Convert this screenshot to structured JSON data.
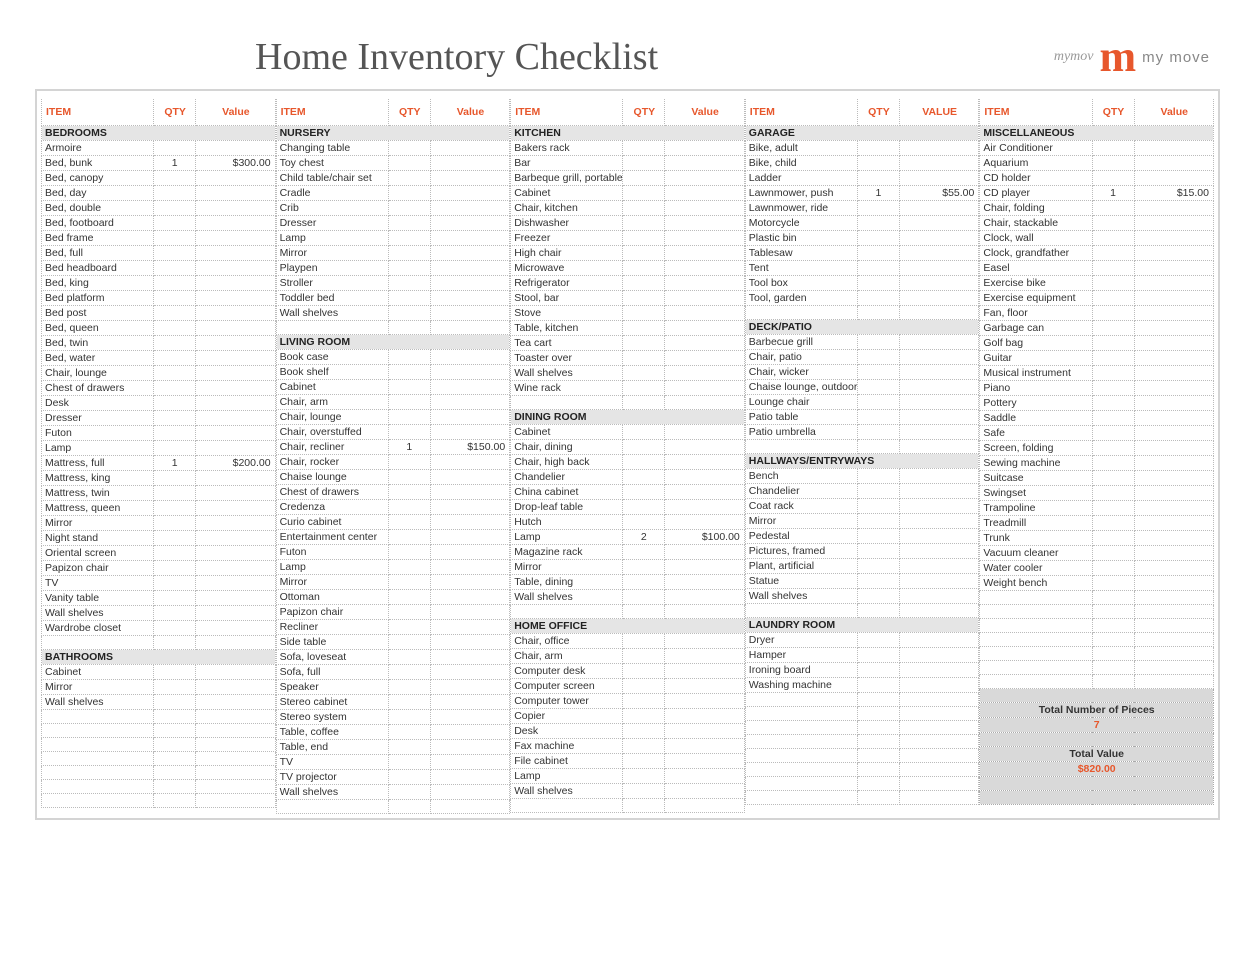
{
  "title": "Home Inventory Checklist",
  "logo": {
    "gray": "mymov",
    "m": "m",
    "sub": "my move"
  },
  "headers": {
    "item": "ITEM",
    "qty": "QTY",
    "value": "Value",
    "value_caps": "VALUE"
  },
  "summary": {
    "pieces_label": "Total Number of Pieces",
    "pieces_value": "7",
    "total_label": "Total Value",
    "total_value": "$820.00"
  },
  "columns": [
    [
      {
        "section": "BEDROOMS"
      },
      {
        "item": "Armoire",
        "qty": "",
        "val": ""
      },
      {
        "item": "Bed, bunk",
        "qty": "1",
        "val": "$300.00"
      },
      {
        "item": "Bed, canopy",
        "qty": "",
        "val": ""
      },
      {
        "item": "Bed, day",
        "qty": "",
        "val": ""
      },
      {
        "item": "Bed, double",
        "qty": "",
        "val": ""
      },
      {
        "item": "Bed, footboard",
        "qty": "",
        "val": ""
      },
      {
        "item": "Bed frame",
        "qty": "",
        "val": ""
      },
      {
        "item": "Bed, full",
        "qty": "",
        "val": ""
      },
      {
        "item": "Bed headboard",
        "qty": "",
        "val": ""
      },
      {
        "item": "Bed, king",
        "qty": "",
        "val": ""
      },
      {
        "item": "Bed platform",
        "qty": "",
        "val": ""
      },
      {
        "item": "Bed post",
        "qty": "",
        "val": ""
      },
      {
        "item": "Bed, queen",
        "qty": "",
        "val": ""
      },
      {
        "item": "Bed, twin",
        "qty": "",
        "val": ""
      },
      {
        "item": "Bed, water",
        "qty": "",
        "val": ""
      },
      {
        "item": "Chair, lounge",
        "qty": "",
        "val": ""
      },
      {
        "item": "Chest of drawers",
        "qty": "",
        "val": ""
      },
      {
        "item": "Desk",
        "qty": "",
        "val": ""
      },
      {
        "item": "Dresser",
        "qty": "",
        "val": ""
      },
      {
        "item": "Futon",
        "qty": "",
        "val": ""
      },
      {
        "item": "Lamp",
        "qty": "",
        "val": ""
      },
      {
        "item": "Mattress, full",
        "qty": "1",
        "val": "$200.00"
      },
      {
        "item": "Mattress, king",
        "qty": "",
        "val": ""
      },
      {
        "item": "Mattress, twin",
        "qty": "",
        "val": ""
      },
      {
        "item": "Mattress, queen",
        "qty": "",
        "val": ""
      },
      {
        "item": "Mirror",
        "qty": "",
        "val": ""
      },
      {
        "item": "Night stand",
        "qty": "",
        "val": ""
      },
      {
        "item": "Oriental screen",
        "qty": "",
        "val": ""
      },
      {
        "item": "Papizon chair",
        "qty": "",
        "val": ""
      },
      {
        "item": "TV",
        "qty": "",
        "val": ""
      },
      {
        "item": "Vanity table",
        "qty": "",
        "val": ""
      },
      {
        "item": "Wall shelves",
        "qty": "",
        "val": ""
      },
      {
        "item": "Wardrobe closet",
        "qty": "",
        "val": ""
      },
      {
        "item": "",
        "qty": "",
        "val": ""
      },
      {
        "section": "BATHROOMS"
      },
      {
        "item": "Cabinet",
        "qty": "",
        "val": ""
      },
      {
        "item": "Mirror",
        "qty": "",
        "val": ""
      },
      {
        "item": "Wall shelves",
        "qty": "",
        "val": ""
      },
      {
        "item": "",
        "qty": "",
        "val": ""
      },
      {
        "item": "",
        "qty": "",
        "val": ""
      },
      {
        "item": "",
        "qty": "",
        "val": ""
      },
      {
        "item": "",
        "qty": "",
        "val": ""
      },
      {
        "item": "",
        "qty": "",
        "val": ""
      },
      {
        "item": "",
        "qty": "",
        "val": ""
      },
      {
        "item": "",
        "qty": "",
        "val": ""
      }
    ],
    [
      {
        "section": "NURSERY"
      },
      {
        "item": "Changing table",
        "qty": "",
        "val": ""
      },
      {
        "item": "Toy chest",
        "qty": "",
        "val": ""
      },
      {
        "item": "Child table/chair set",
        "qty": "",
        "val": ""
      },
      {
        "item": "Cradle",
        "qty": "",
        "val": ""
      },
      {
        "item": "Crib",
        "qty": "",
        "val": ""
      },
      {
        "item": "Dresser",
        "qty": "",
        "val": ""
      },
      {
        "item": "Lamp",
        "qty": "",
        "val": ""
      },
      {
        "item": "Mirror",
        "qty": "",
        "val": ""
      },
      {
        "item": "Playpen",
        "qty": "",
        "val": ""
      },
      {
        "item": "Stroller",
        "qty": "",
        "val": ""
      },
      {
        "item": "Toddler bed",
        "qty": "",
        "val": ""
      },
      {
        "item": "Wall shelves",
        "qty": "",
        "val": ""
      },
      {
        "item": "",
        "qty": "",
        "val": ""
      },
      {
        "section": "LIVING ROOM"
      },
      {
        "item": "Book case",
        "qty": "",
        "val": ""
      },
      {
        "item": "Book shelf",
        "qty": "",
        "val": ""
      },
      {
        "item": "Cabinet",
        "qty": "",
        "val": ""
      },
      {
        "item": "Chair, arm",
        "qty": "",
        "val": ""
      },
      {
        "item": "Chair, lounge",
        "qty": "",
        "val": ""
      },
      {
        "item": "Chair, overstuffed",
        "qty": "",
        "val": ""
      },
      {
        "item": "Chair, recliner",
        "qty": "1",
        "val": "$150.00"
      },
      {
        "item": "Chair, rocker",
        "qty": "",
        "val": ""
      },
      {
        "item": "Chaise lounge",
        "qty": "",
        "val": ""
      },
      {
        "item": "Chest of drawers",
        "qty": "",
        "val": ""
      },
      {
        "item": "Credenza",
        "qty": "",
        "val": ""
      },
      {
        "item": "Curio cabinet",
        "qty": "",
        "val": ""
      },
      {
        "item": "Entertainment center",
        "qty": "",
        "val": ""
      },
      {
        "item": "Futon",
        "qty": "",
        "val": ""
      },
      {
        "item": "Lamp",
        "qty": "",
        "val": ""
      },
      {
        "item": "Mirror",
        "qty": "",
        "val": ""
      },
      {
        "item": "Ottoman",
        "qty": "",
        "val": ""
      },
      {
        "item": "Papizon chair",
        "qty": "",
        "val": ""
      },
      {
        "item": "Recliner",
        "qty": "",
        "val": ""
      },
      {
        "item": "Side table",
        "qty": "",
        "val": ""
      },
      {
        "item": "Sofa, loveseat",
        "qty": "",
        "val": ""
      },
      {
        "item": "Sofa, full",
        "qty": "",
        "val": ""
      },
      {
        "item": "Speaker",
        "qty": "",
        "val": ""
      },
      {
        "item": "Stereo cabinet",
        "qty": "",
        "val": ""
      },
      {
        "item": "Stereo system",
        "qty": "",
        "val": ""
      },
      {
        "item": "Table, coffee",
        "qty": "",
        "val": ""
      },
      {
        "item": "Table, end",
        "qty": "",
        "val": ""
      },
      {
        "item": "TV",
        "qty": "",
        "val": ""
      },
      {
        "item": "TV projector",
        "qty": "",
        "val": ""
      },
      {
        "item": "Wall shelves",
        "qty": "",
        "val": ""
      },
      {
        "item": "",
        "qty": "",
        "val": ""
      }
    ],
    [
      {
        "section": "KITCHEN"
      },
      {
        "item": "Bakers rack",
        "qty": "",
        "val": ""
      },
      {
        "item": "Bar",
        "qty": "",
        "val": ""
      },
      {
        "item": "Barbeque grill, portable",
        "qty": "",
        "val": ""
      },
      {
        "item": "Cabinet",
        "qty": "",
        "val": ""
      },
      {
        "item": "Chair, kitchen",
        "qty": "",
        "val": ""
      },
      {
        "item": "Dishwasher",
        "qty": "",
        "val": ""
      },
      {
        "item": "Freezer",
        "qty": "",
        "val": ""
      },
      {
        "item": "High chair",
        "qty": "",
        "val": ""
      },
      {
        "item": "Microwave",
        "qty": "",
        "val": ""
      },
      {
        "item": "Refrigerator",
        "qty": "",
        "val": ""
      },
      {
        "item": "Stool, bar",
        "qty": "",
        "val": ""
      },
      {
        "item": "Stove",
        "qty": "",
        "val": ""
      },
      {
        "item": "Table, kitchen",
        "qty": "",
        "val": ""
      },
      {
        "item": "Tea cart",
        "qty": "",
        "val": ""
      },
      {
        "item": "Toaster over",
        "qty": "",
        "val": ""
      },
      {
        "item": "Wall shelves",
        "qty": "",
        "val": ""
      },
      {
        "item": "Wine rack",
        "qty": "",
        "val": ""
      },
      {
        "item": "",
        "qty": "",
        "val": ""
      },
      {
        "section": "DINING ROOM"
      },
      {
        "item": "Cabinet",
        "qty": "",
        "val": ""
      },
      {
        "item": "Chair, dining",
        "qty": "",
        "val": ""
      },
      {
        "item": "Chair, high back",
        "qty": "",
        "val": ""
      },
      {
        "item": "Chandelier",
        "qty": "",
        "val": ""
      },
      {
        "item": "China cabinet",
        "qty": "",
        "val": ""
      },
      {
        "item": "Drop-leaf table",
        "qty": "",
        "val": ""
      },
      {
        "item": "Hutch",
        "qty": "",
        "val": ""
      },
      {
        "item": "Lamp",
        "qty": "2",
        "val": "$100.00"
      },
      {
        "item": "Magazine rack",
        "qty": "",
        "val": ""
      },
      {
        "item": "Mirror",
        "qty": "",
        "val": ""
      },
      {
        "item": "Table, dining",
        "qty": "",
        "val": ""
      },
      {
        "item": "Wall shelves",
        "qty": "",
        "val": ""
      },
      {
        "item": "",
        "qty": "",
        "val": ""
      },
      {
        "section": "HOME OFFICE"
      },
      {
        "item": "Chair, office",
        "qty": "",
        "val": ""
      },
      {
        "item": "Chair, arm",
        "qty": "",
        "val": ""
      },
      {
        "item": "Computer desk",
        "qty": "",
        "val": ""
      },
      {
        "item": "Computer screen",
        "qty": "",
        "val": ""
      },
      {
        "item": "Computer tower",
        "qty": "",
        "val": ""
      },
      {
        "item": "Copier",
        "qty": "",
        "val": ""
      },
      {
        "item": "Desk",
        "qty": "",
        "val": ""
      },
      {
        "item": "Fax machine",
        "qty": "",
        "val": ""
      },
      {
        "item": "File cabinet",
        "qty": "",
        "val": ""
      },
      {
        "item": "Lamp",
        "qty": "",
        "val": ""
      },
      {
        "item": "Wall shelves",
        "qty": "",
        "val": ""
      },
      {
        "item": "",
        "qty": "",
        "val": ""
      }
    ],
    [
      {
        "section": "GARAGE"
      },
      {
        "item": "Bike, adult",
        "qty": "",
        "val": ""
      },
      {
        "item": "Bike, child",
        "qty": "",
        "val": ""
      },
      {
        "item": "Ladder",
        "qty": "",
        "val": ""
      },
      {
        "item": "Lawnmower, push",
        "qty": "1",
        "val": "$55.00"
      },
      {
        "item": "Lawnmower, ride",
        "qty": "",
        "val": ""
      },
      {
        "item": "Motorcycle",
        "qty": "",
        "val": ""
      },
      {
        "item": "Plastic bin",
        "qty": "",
        "val": ""
      },
      {
        "item": "Tablesaw",
        "qty": "",
        "val": ""
      },
      {
        "item": "Tent",
        "qty": "",
        "val": ""
      },
      {
        "item": "Tool box",
        "qty": "",
        "val": ""
      },
      {
        "item": "Tool, garden",
        "qty": "",
        "val": ""
      },
      {
        "item": "",
        "qty": "",
        "val": ""
      },
      {
        "section": "DECK/PATIO"
      },
      {
        "item": "Barbecue grill",
        "qty": "",
        "val": ""
      },
      {
        "item": "Chair, patio",
        "qty": "",
        "val": ""
      },
      {
        "item": "Chair, wicker",
        "qty": "",
        "val": ""
      },
      {
        "item": "Chaise lounge, outdoor",
        "qty": "",
        "val": ""
      },
      {
        "item": "Lounge chair",
        "qty": "",
        "val": ""
      },
      {
        "item": "Patio table",
        "qty": "",
        "val": ""
      },
      {
        "item": "Patio umbrella",
        "qty": "",
        "val": ""
      },
      {
        "item": "",
        "qty": "",
        "val": ""
      },
      {
        "section": "HALLWAYS/ENTRYWAYS"
      },
      {
        "item": "Bench",
        "qty": "",
        "val": ""
      },
      {
        "item": "Chandelier",
        "qty": "",
        "val": ""
      },
      {
        "item": "Coat rack",
        "qty": "",
        "val": ""
      },
      {
        "item": "Mirror",
        "qty": "",
        "val": ""
      },
      {
        "item": "Pedestal",
        "qty": "",
        "val": ""
      },
      {
        "item": "Pictures, framed",
        "qty": "",
        "val": ""
      },
      {
        "item": "Plant, artificial",
        "qty": "",
        "val": ""
      },
      {
        "item": "Statue",
        "qty": "",
        "val": ""
      },
      {
        "item": "Wall shelves",
        "qty": "",
        "val": ""
      },
      {
        "item": "",
        "qty": "",
        "val": ""
      },
      {
        "section": "LAUNDRY ROOM"
      },
      {
        "item": "Dryer",
        "qty": "",
        "val": ""
      },
      {
        "item": "Hamper",
        "qty": "",
        "val": ""
      },
      {
        "item": "Ironing board",
        "qty": "",
        "val": ""
      },
      {
        "item": "Washing machine",
        "qty": "",
        "val": ""
      },
      {
        "item": "",
        "qty": "",
        "val": ""
      },
      {
        "item": "",
        "qty": "",
        "val": ""
      },
      {
        "item": "",
        "qty": "",
        "val": ""
      },
      {
        "item": "",
        "qty": "",
        "val": ""
      },
      {
        "item": "",
        "qty": "",
        "val": ""
      },
      {
        "item": "",
        "qty": "",
        "val": ""
      },
      {
        "item": "",
        "qty": "",
        "val": ""
      },
      {
        "item": "",
        "qty": "",
        "val": ""
      }
    ],
    [
      {
        "section": "MISCELLANEOUS"
      },
      {
        "item": "Air Conditioner",
        "qty": "",
        "val": ""
      },
      {
        "item": "Aquarium",
        "qty": "",
        "val": ""
      },
      {
        "item": "CD holder",
        "qty": "",
        "val": ""
      },
      {
        "item": "CD player",
        "qty": "1",
        "val": "$15.00"
      },
      {
        "item": "Chair, folding",
        "qty": "",
        "val": ""
      },
      {
        "item": "Chair, stackable",
        "qty": "",
        "val": ""
      },
      {
        "item": "Clock, wall",
        "qty": "",
        "val": ""
      },
      {
        "item": "Clock, grandfather",
        "qty": "",
        "val": ""
      },
      {
        "item": "Easel",
        "qty": "",
        "val": ""
      },
      {
        "item": "Exercise bike",
        "qty": "",
        "val": ""
      },
      {
        "item": "Exercise equipment",
        "qty": "",
        "val": ""
      },
      {
        "item": "Fan, floor",
        "qty": "",
        "val": ""
      },
      {
        "item": "Garbage can",
        "qty": "",
        "val": ""
      },
      {
        "item": "Golf bag",
        "qty": "",
        "val": ""
      },
      {
        "item": "Guitar",
        "qty": "",
        "val": ""
      },
      {
        "item": "Musical instrument",
        "qty": "",
        "val": ""
      },
      {
        "item": "Piano",
        "qty": "",
        "val": ""
      },
      {
        "item": "Pottery",
        "qty": "",
        "val": ""
      },
      {
        "item": "Saddle",
        "qty": "",
        "val": ""
      },
      {
        "item": "Safe",
        "qty": "",
        "val": ""
      },
      {
        "item": "Screen, folding",
        "qty": "",
        "val": ""
      },
      {
        "item": "Sewing machine",
        "qty": "",
        "val": ""
      },
      {
        "item": "Suitcase",
        "qty": "",
        "val": ""
      },
      {
        "item": "Swingset",
        "qty": "",
        "val": ""
      },
      {
        "item": "Trampoline",
        "qty": "",
        "val": ""
      },
      {
        "item": "Treadmill",
        "qty": "",
        "val": ""
      },
      {
        "item": "Trunk",
        "qty": "",
        "val": ""
      },
      {
        "item": "Vacuum cleaner",
        "qty": "",
        "val": ""
      },
      {
        "item": "Water cooler",
        "qty": "",
        "val": ""
      },
      {
        "item": "Weight bench",
        "qty": "",
        "val": ""
      },
      {
        "item": "",
        "qty": "",
        "val": ""
      },
      {
        "item": "",
        "qty": "",
        "val": ""
      },
      {
        "item": "",
        "qty": "",
        "val": ""
      },
      {
        "item": "",
        "qty": "",
        "val": ""
      },
      {
        "item": "",
        "qty": "",
        "val": ""
      },
      {
        "item": "",
        "qty": "",
        "val": ""
      },
      {
        "item": "",
        "qty": "",
        "val": ""
      }
    ]
  ]
}
